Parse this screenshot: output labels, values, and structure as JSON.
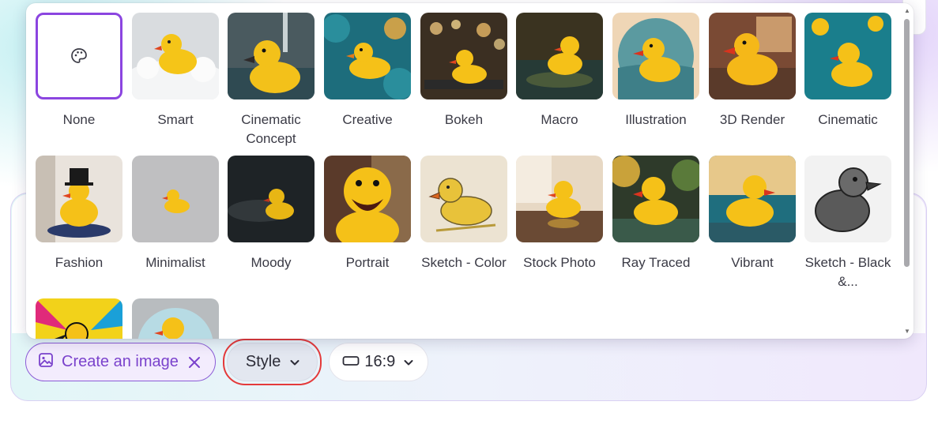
{
  "styles": {
    "row1": [
      {
        "label": "None",
        "icon": "palette-icon",
        "selected": true
      },
      {
        "label": "Smart"
      },
      {
        "label": "Cinematic Concept"
      },
      {
        "label": "Creative"
      },
      {
        "label": "Bokeh"
      },
      {
        "label": "Macro"
      },
      {
        "label": "Illustration"
      },
      {
        "label": "3D Render"
      },
      {
        "label": "Cinematic"
      }
    ],
    "row2": [
      {
        "label": "Fashion"
      },
      {
        "label": "Minimalist"
      },
      {
        "label": "Moody"
      },
      {
        "label": "Portrait"
      },
      {
        "label": "Sketch - Color"
      },
      {
        "label": "Stock Photo"
      },
      {
        "label": "Ray Traced"
      },
      {
        "label": "Vibrant"
      },
      {
        "label": "Sketch - Black &..."
      }
    ]
  },
  "toolbar": {
    "create_label": "Create an image",
    "create_icon": "image-icon",
    "close_icon": "close-icon",
    "style_label": "Style",
    "ratio_label": "16:9",
    "ratio_icon": "aspect-ratio-icon",
    "chevron_icon": "chevron-down-icon"
  },
  "colors": {
    "accent": "#8b45e0",
    "highlight": "#e43a3a",
    "duck": "#f6c21a"
  }
}
